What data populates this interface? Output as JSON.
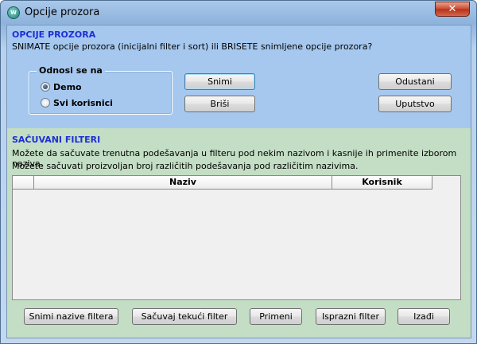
{
  "window": {
    "title": "Opcije prozora",
    "icon": "app-logo-icon",
    "close_glyph": "✕"
  },
  "options_section": {
    "heading": "OPCIJE PROZORA",
    "description": "SNIMATE opcije prozora (inicijalni filter i sort) ili BRISETE snimljene opcije prozora?",
    "group_title": "Odnosi se na",
    "radios": [
      {
        "label": "Demo",
        "checked": true
      },
      {
        "label": "Svi korisnici",
        "checked": false
      }
    ],
    "save_label": "Snimi",
    "delete_label": "Briši",
    "cancel_label": "Odustani",
    "help_label": "Uputstvo"
  },
  "filters_section": {
    "heading": "SAČUVANI FILTERI",
    "line1": "Možete da sačuvate trenutna podešavanja u filteru pod nekim nazivom i kasnije ih primenite izborom naziva.",
    "line2": "Možete sačuvati proizvoljan broj različitih podešavanja pod različitim nazivima.",
    "columns": [
      "Naziv",
      "Korisnik"
    ],
    "rows": []
  },
  "footer_buttons": {
    "save_names": "Snimi nazive filtera",
    "save_current": "Sačuvaj tekući filter",
    "apply": "Primeni",
    "clear": "Isprazni filter",
    "exit": "Izađi"
  },
  "colors": {
    "heading_blue": "#1d2fd6",
    "top_panel": "#a6c8ef",
    "bottom_panel": "#c3dec4",
    "close_red": "#c8462e"
  }
}
